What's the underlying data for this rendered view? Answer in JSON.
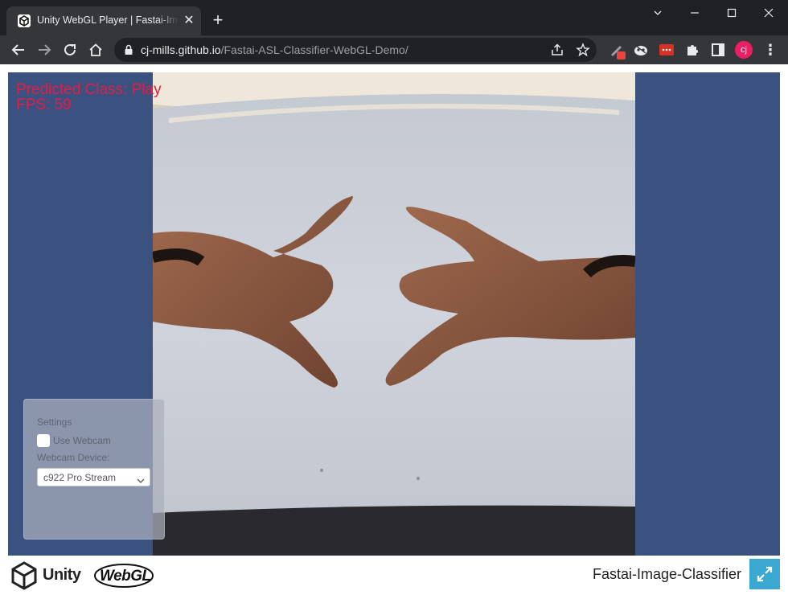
{
  "browser": {
    "tab": {
      "title": "Unity WebGL Player | Fastai-Image-Classifier",
      "close": "✕"
    },
    "new_tab": "+",
    "url": {
      "host": "cj-mills.github.io",
      "path": "/Fastai-ASL-Classifier-WebGL-Demo/"
    },
    "profile_initials": "cj",
    "profile_color": "#e91e63"
  },
  "overlay": {
    "predicted_class": "Predicted Class: Play",
    "fps": "FPS: 59",
    "text_color": "#e11d48"
  },
  "settings": {
    "title": "Settings",
    "use_webcam_label": "Use Webcam",
    "use_webcam_checked": false,
    "webcam_device_label": "Webcam Device:",
    "webcam_device_value": "c922 Pro Stream"
  },
  "footer": {
    "unity_label": "Unity",
    "webgl_label": "WebGL",
    "build_title": "Fastai-Image-Classifier",
    "fullscreen_color": "#3aa8d0"
  },
  "colors": {
    "canvas_bg": "#3b5280",
    "chrome_dark": "#202124",
    "chrome_toolbar": "#35363a"
  }
}
